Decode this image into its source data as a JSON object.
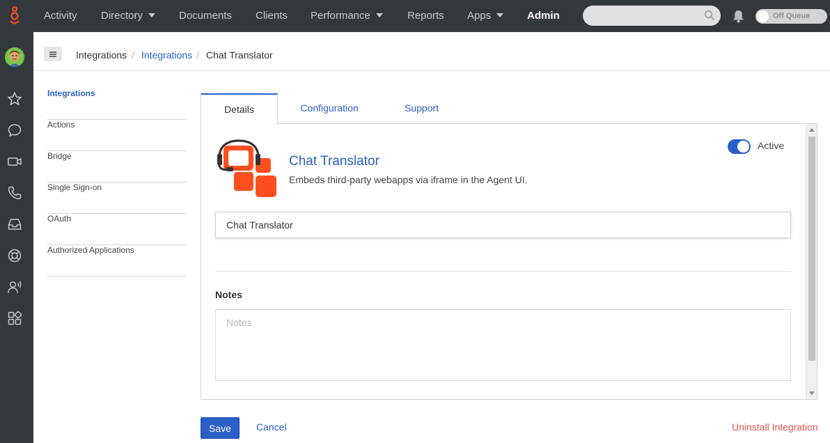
{
  "colors": {
    "nav_background": "#33383d",
    "accent": "#2a60c8",
    "brand_orange": "#ff4f1f",
    "danger": "#e4544f"
  },
  "topnav": {
    "logo_icon": "genesys-logo-icon",
    "items": [
      {
        "label": "Activity",
        "dropdown": false
      },
      {
        "label": "Directory",
        "dropdown": true
      },
      {
        "label": "Documents",
        "dropdown": false
      },
      {
        "label": "Clients",
        "dropdown": false
      },
      {
        "label": "Performance",
        "dropdown": true
      },
      {
        "label": "Reports",
        "dropdown": false
      },
      {
        "label": "Apps",
        "dropdown": true
      },
      {
        "label": "Admin",
        "dropdown": false,
        "active": true
      }
    ],
    "search": {
      "placeholder": "",
      "icon": "search-icon"
    },
    "notifications_icon": "bell-icon",
    "queue_toggle": {
      "label": "Off Queue",
      "on": false
    }
  },
  "rail": {
    "icons": [
      "avatar",
      "star-icon",
      "chat-icon",
      "video-icon",
      "phone-icon",
      "inbox-icon",
      "support-icon",
      "voice-user-icon",
      "apps-grid-icon"
    ]
  },
  "breadcrumb": {
    "menu_icon": "hamburger-icon",
    "items": [
      {
        "label": "Integrations",
        "link": false
      },
      {
        "label": "Integrations",
        "link": true
      },
      {
        "label": "Chat Translator",
        "link": false
      }
    ],
    "separator": "/"
  },
  "subnav": {
    "items": [
      {
        "label": "Integrations",
        "active": true
      },
      {
        "label": "Actions"
      },
      {
        "label": "Bridge"
      },
      {
        "label": "Single Sign-on"
      },
      {
        "label": "OAuth"
      },
      {
        "label": "Authorized Applications"
      }
    ]
  },
  "tabs": [
    {
      "label": "Details",
      "active": true
    },
    {
      "label": "Configuration"
    },
    {
      "label": "Support"
    }
  ],
  "details": {
    "app_icon": "chat-translator-logo",
    "title": "Chat Translator",
    "description": "Embeds third-party webapps via iframe in the Agent UI.",
    "active_toggle": {
      "label": "Active",
      "on": true
    },
    "name_value": "Chat Translator",
    "notes_label": "Notes",
    "notes_placeholder": "Notes",
    "notes_value": ""
  },
  "footer": {
    "save_label": "Save",
    "cancel_label": "Cancel",
    "uninstall_label": "Uninstall Integration"
  }
}
